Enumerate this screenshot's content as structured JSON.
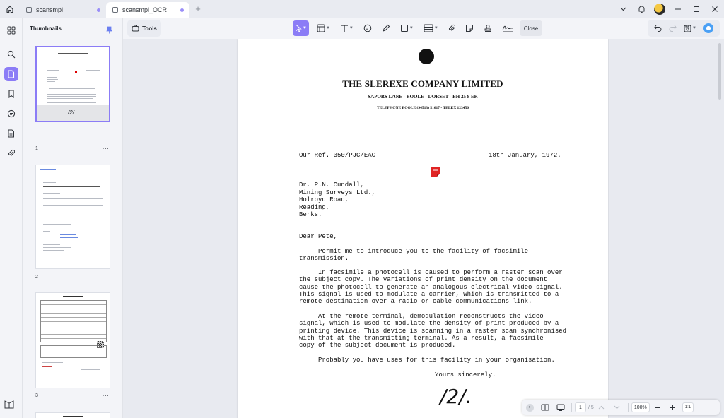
{
  "titlebar": {
    "tabs": [
      {
        "label": "scansmpl",
        "active": false
      },
      {
        "label": "scansmpl_OCR",
        "active": true
      }
    ]
  },
  "thumbnails": {
    "title": "Thumbnails",
    "pages": [
      {
        "number": "1",
        "more": "..."
      },
      {
        "number": "2",
        "more": "..."
      },
      {
        "number": "3",
        "more": "..."
      }
    ]
  },
  "toolbar": {
    "tools_label": "Tools",
    "close_label": "Close"
  },
  "document": {
    "company": "THE SLEREXE COMPANY LIMITED",
    "address": "SAPORS LANE - BOOLE - DORSET - BH 25 8 ER",
    "phone": "TELEPHONE BOOLE (94513) 51617 - TELEX 123456",
    "ref": "Our Ref. 350/PJC/EAC",
    "date": "18th January, 1972.",
    "recipient": [
      "Dr. P.N. Cundall,",
      "Mining Surveys Ltd.,",
      "Holroyd Road,",
      "Reading,",
      "Berks."
    ],
    "salutation": "Dear Pete,",
    "paragraphs": [
      [
        "     Permit me to introduce you to the facility of facsimile",
        "transmission."
      ],
      [
        "     In facsimile a photocell is caused to perform a raster scan over",
        "the subject copy. The variations of print density on the document",
        "cause the photocell to generate an analogous electrical video signal.",
        "This signal is used to modulate a carrier, which is transmitted to a",
        "remote destination over a radio or cable communications link."
      ],
      [
        "     At the remote terminal, demodulation reconstructs the video",
        "signal, which is used to modulate the density of print produced by a",
        "printing device. This device is scanning in a raster scan synchronised",
        "with that at the transmitting terminal. As a result, a facsimile",
        "copy of the subject document is produced."
      ],
      [
        "     Probably you have uses for this facility in your organisation."
      ]
    ],
    "closing": "Yours sincerely.",
    "signature": "/2/."
  },
  "bottombar": {
    "current_page": "1",
    "total_pages": "/ 5",
    "zoom": "100%",
    "fit_label": "1:1"
  },
  "colors": {
    "accent": "#8b7cf6",
    "canvas_bg": "#e8eaf0",
    "panel_bg": "#f3f4f8"
  }
}
